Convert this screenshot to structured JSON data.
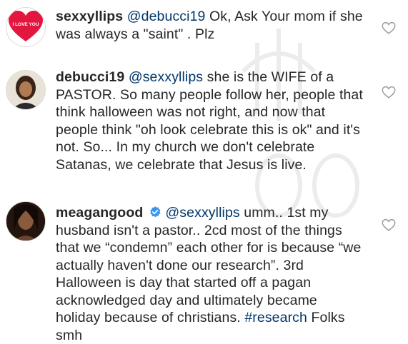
{
  "comments": [
    {
      "username": "sexxyllips",
      "mention": "@debucci19",
      "text": " Ok, Ask Your mom if she was always a \"saint\" . Plz",
      "avatar_text": "I LOVE YOU",
      "avatar_icon": "heart-avatar"
    },
    {
      "username": "debucci19",
      "mention": "@sexxyllips",
      "text": " she is the WIFE of a PASTOR. So many people follow her, people that think halloween was not right, and now that people think \"oh look celebrate this is ok\" and it's not. So... In my church we don't celebrate Satanas, we celebrate that Jesus is live.",
      "avatar_icon": "profile-photo"
    },
    {
      "username": "meagangood",
      "verified": true,
      "mention": "@sexxyllips",
      "text": " umm.. 1st my husband isn't a pastor.. 2cd most of the things that we “condemn” each other for is because “we actually haven't done our research”. 3rd Halloween is day that started off a pagan acknowledged day and ultimately became holiday because of christians. ",
      "hashtag": "#research",
      "text_after": " Folks smh",
      "avatar_icon": "profile-photo"
    }
  ],
  "colors": {
    "text": "#262626",
    "link": "#003569",
    "verified": "#3897f0",
    "heart_outline": "#9a9a9a"
  },
  "icons": [
    "heart-outline-icon",
    "verified-badge-icon"
  ]
}
